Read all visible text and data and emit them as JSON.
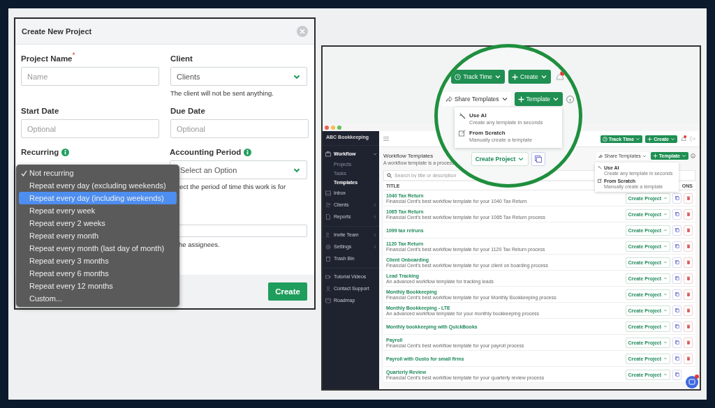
{
  "modal": {
    "title": "Create New Project",
    "rows": [
      [
        {
          "label": "Project Name",
          "required_mark": "*",
          "info": false,
          "control": {
            "kind": "input",
            "placeholder": "Name"
          }
        },
        {
          "label": "Client",
          "info": false,
          "control": {
            "kind": "select",
            "value": "Clients"
          },
          "help": "The client will not be sent anything."
        }
      ],
      [
        {
          "label": "Start Date",
          "info": false,
          "control": {
            "kind": "input",
            "placeholder": "Optional"
          }
        },
        {
          "label": "Due Date",
          "info": false,
          "control": {
            "kind": "input",
            "placeholder": "Optional"
          }
        }
      ],
      [
        {
          "label": "Recurring",
          "info": true
        },
        {
          "label": "Accounting Period",
          "info": true,
          "control": {
            "kind": "select",
            "value": "Select an Option"
          },
          "help": "ect the period of time this work is for"
        }
      ],
      [
        {},
        {
          "control": {
            "kind": "input"
          },
          "help": "he assignees."
        }
      ]
    ],
    "recurrence_menu": [
      {
        "label": "Not recurring",
        "checked": true,
        "selected": false
      },
      {
        "label": "Repeat every day (excluding weekends)",
        "checked": false,
        "selected": false
      },
      {
        "label": "Repeat every day (including weekends)",
        "checked": false,
        "selected": true
      },
      {
        "label": "Repeat every week",
        "checked": false,
        "selected": false
      },
      {
        "label": "Repeat every 2 weeks",
        "checked": false,
        "selected": false
      },
      {
        "label": "Repeat every month",
        "checked": false,
        "selected": false
      },
      {
        "label": "Repeat every month (last day of month)",
        "checked": false,
        "selected": false
      },
      {
        "label": "Repeat every 3 months",
        "checked": false,
        "selected": false
      },
      {
        "label": "Repeat every 6 months",
        "checked": false,
        "selected": false
      },
      {
        "label": "Repeat every 12 months",
        "checked": false,
        "selected": false
      },
      {
        "label": "Custom...",
        "checked": false,
        "selected": false
      }
    ],
    "create_button": "Create"
  },
  "app": {
    "sidebar": {
      "org": "ABC Bookkeeping",
      "groups": [
        [
          {
            "label": "Workflow",
            "expanded": true,
            "children": [
              {
                "label": "Projects",
                "selected": false
              },
              {
                "label": "Tasks",
                "selected": false
              },
              {
                "label": "Templates",
                "selected": true
              }
            ]
          },
          {
            "label": "Inbox"
          },
          {
            "label": "Clients",
            "expanded": false
          },
          {
            "label": "Reports",
            "expanded": false
          }
        ],
        [
          {
            "label": "Invite Team",
            "expanded": false
          },
          {
            "label": "Settings",
            "expanded": false
          },
          {
            "label": "Trash Bin"
          }
        ],
        [
          {
            "label": "Tutorial Videos"
          },
          {
            "label": "Contact Support"
          },
          {
            "label": "Roadmap"
          }
        ]
      ]
    },
    "topbar": {
      "buttons": [
        {
          "label": "Track Time",
          "kind": "timer"
        },
        {
          "label": "Create",
          "kind": "plus"
        }
      ]
    },
    "header": {
      "title": "Workflow Templates",
      "subtitle": "A workflow template is a process",
      "share": "Share Templates",
      "template_button": "Template"
    },
    "template_menu": [
      {
        "title": "Use AI",
        "description": "Create any template in seconds"
      },
      {
        "title": "From Scratch",
        "description": "Manually create a template"
      }
    ],
    "search": {
      "placeholder": "Search by title or description"
    },
    "table": {
      "columns": [
        "TITLE",
        "ONS"
      ],
      "rows": [
        {
          "title": "1040 Tax Return",
          "description": "Financial Cent's best workflow template for your 1040 Tax Return",
          "action": "Create Project"
        },
        {
          "title": "1065 Tax Return",
          "description": "Financial Cent's best workflow template for your 1065 Tax Return process",
          "action": "Create Project"
        },
        {
          "title": "1099 tax retruns",
          "action": "Create Project"
        },
        {
          "title": "1120 Tax Return",
          "description": "Financial Cent's best workflow template for your 1120 Tax Return process",
          "action": "Create Project"
        },
        {
          "title": "Client Onboarding",
          "description": "Financial Cent's best workflow template for your client on boarding process",
          "action": "Create Project"
        },
        {
          "title": "Lead Tracking",
          "description": "An advanced workflow template for tracking leads",
          "action": "Create Project"
        },
        {
          "title": "Monthly Bookkeeping",
          "description": "Financial Cent's best workflow template for your Monthly Bookkeeping process",
          "action": "Create Project"
        },
        {
          "title": "Monthly Bookkeeping - LTE",
          "description": "An advanced workflow template for your monthly bookkeeping process",
          "action": "Create Project"
        },
        {
          "title": "Monthly bookkeeping with QuickBooks",
          "action": "Create Project"
        },
        {
          "title": "Payroll",
          "description": "Financial Cent's best workflow template for your payroll process",
          "action": "Create Project"
        },
        {
          "title": "Payroll with Gusto for small firms",
          "action": "Create Project"
        },
        {
          "title": "Quarterly Review",
          "description": "Financial Cent's best workflow template for your quarterly review process",
          "action": "Create Project",
          "delete_visible": false
        }
      ]
    },
    "magnifier": {
      "buttons": [
        {
          "label": "Track Time",
          "kind": "timer"
        },
        {
          "label": "Create",
          "kind": "plus"
        }
      ],
      "share": "Share Templates",
      "template_button": "Template",
      "menu": [
        {
          "title": "Use AI",
          "description": "Create any template in seconds"
        },
        {
          "title": "From Scratch",
          "description": "Manually create a template"
        }
      ],
      "action": "Create Project"
    }
  }
}
